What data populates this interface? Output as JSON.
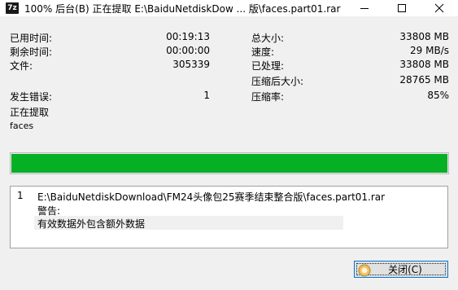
{
  "window": {
    "title": "100% 后台(B) 正在提取 E:\\BaiduNetdiskDow ... 版\\faces.part01.rar",
    "icon_text": "7z"
  },
  "stats_left": [
    {
      "label": "已用时间:",
      "value": "00:19:13"
    },
    {
      "label": "剩余时间:",
      "value": "00:00:00"
    },
    {
      "label": "文件:",
      "value": "305339"
    },
    {
      "label": "发生错误:",
      "value": "1"
    }
  ],
  "stats_right": [
    {
      "label": "总大小:",
      "value": "33808 MB"
    },
    {
      "label": "速度:",
      "value": "29 MB/s"
    },
    {
      "label": "已处理:",
      "value": "33808 MB"
    },
    {
      "label": "压缩后大小:",
      "value": "28765 MB"
    },
    {
      "label": "压缩率:",
      "value": "85%"
    }
  ],
  "status": {
    "operation": "正在提取",
    "current_file": "faces"
  },
  "progress": {
    "percent": 100,
    "color": "#06b025"
  },
  "messages": {
    "number": "1",
    "path": "E:\\BaiduNetdiskDownload\\FM24头像包25赛季结束整合版\\faces.part01.rar",
    "warning_label": "警告:",
    "warning_text": "有效数据外包含额外数据"
  },
  "buttons": {
    "close": "关闭(C)"
  }
}
